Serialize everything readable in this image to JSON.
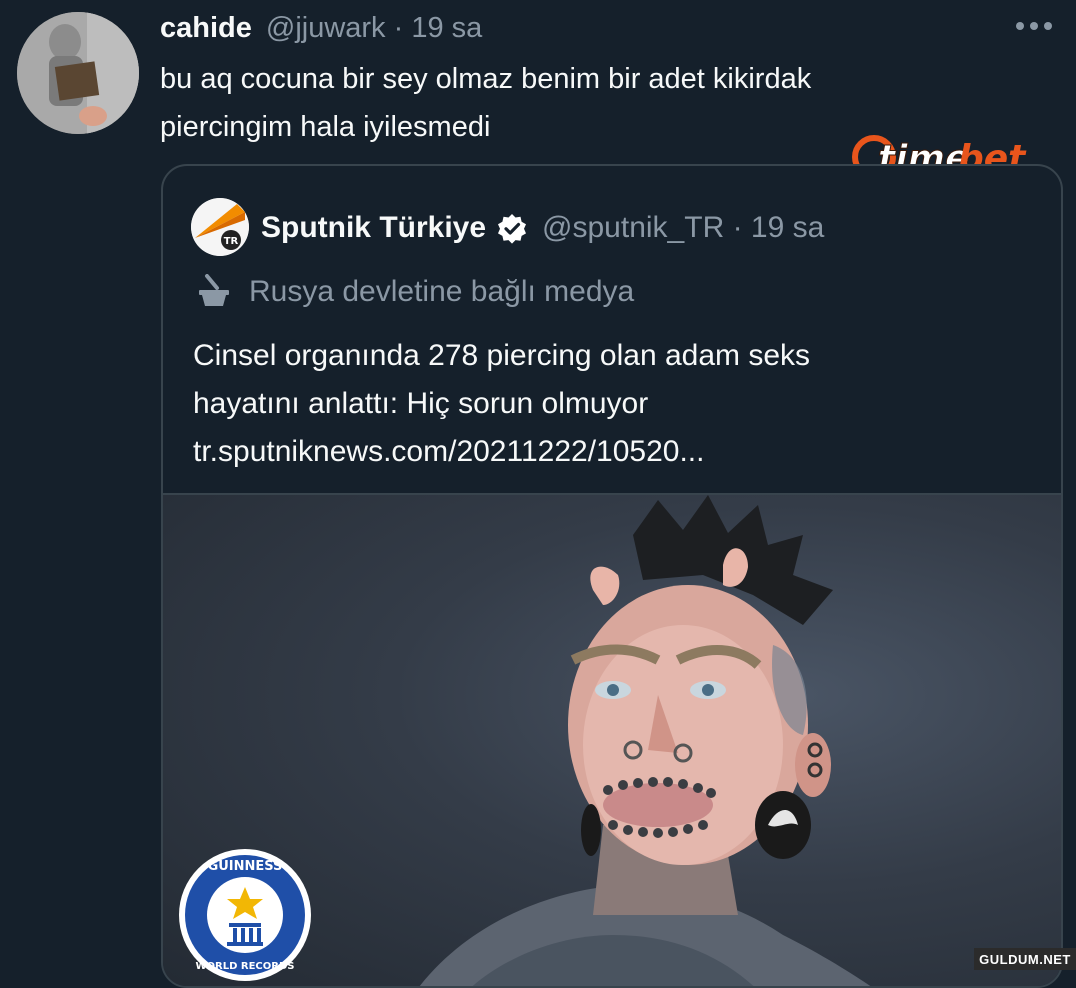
{
  "tweet": {
    "display_name": "cahide",
    "handle_time": "@jjuwark · 19 sa",
    "lines": [
      "bu aq cocuna bir sey olmaz benim bir adet kikirdak",
      "piercingim hala iyilesmedi"
    ]
  },
  "watermark": {
    "brand": "timebet"
  },
  "quote": {
    "avatar_badge": "TR",
    "display_name": "Sputnik Türkiye",
    "handle_time": "@sputnik_TR · 19 sa",
    "state_label": "Rusya devletine bağlı medya",
    "lines": [
      "Cinsel organında 278 piercing olan adam seks",
      "hayatını anlattı: Hiç sorun olmuyor",
      "tr.sputniknews.com/20211222/10520..."
    ]
  },
  "media": {
    "seal_text_top": "GUINNESS",
    "seal_text_bottom": "WORLD RECORDS"
  },
  "footer": {
    "watermark": "GULDUM.NET"
  },
  "colors": {
    "background": "#15202b",
    "text_primary": "#f7f9f9",
    "text_secondary": "#8b98a5",
    "border": "#38444d",
    "verified": "#ffffff",
    "brand_orange": "#e8551c"
  },
  "icons": {
    "more": "more-horizontal-icon",
    "verified": "verified-badge-icon",
    "state_media": "state-media-icon"
  }
}
